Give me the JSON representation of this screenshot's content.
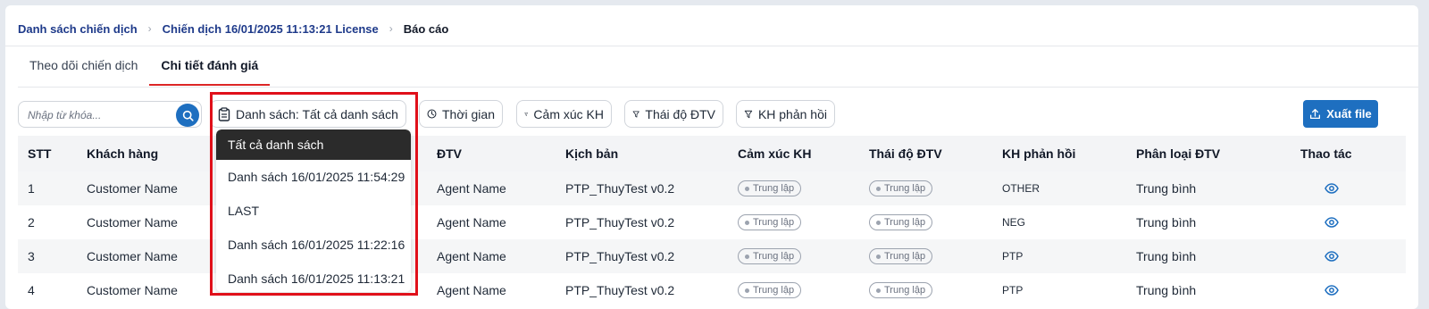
{
  "breadcrumb": {
    "items": [
      "Danh sách chiến dịch",
      "Chiến dịch 16/01/2025 11:13:21 License",
      "Báo cáo"
    ]
  },
  "tabs": [
    {
      "label": "Theo dõi chiến dịch",
      "active": false
    },
    {
      "label": "Chi tiết đánh giá",
      "active": true
    }
  ],
  "toolbar": {
    "search_placeholder": "Nhập từ khóa...",
    "list_filter": "Danh sách: Tất cả danh sách",
    "time_filter": "Thời gian",
    "emotion_filter": "Cảm xúc KH",
    "attitude_filter": "Thái độ ĐTV",
    "feedback_filter": "KH phản hồi",
    "export_label": "Xuất file"
  },
  "dropdown": {
    "options": [
      "Tất cả danh sách",
      "Danh sách 16/01/2025 11:54:29",
      "LAST",
      "Danh sách 16/01/2025 11:22:16",
      "Danh sách 16/01/2025 11:13:21"
    ],
    "selected_index": 0
  },
  "table": {
    "headers": [
      "STT",
      "Khách hàng",
      "ĐTV",
      "Kịch bản",
      "Cảm xúc KH",
      "Thái độ ĐTV",
      "KH phản hồi",
      "Phân loại ĐTV",
      "Thao tác"
    ],
    "rows": [
      {
        "stt": "1",
        "customer": "Customer Name",
        "agent": "Agent Name",
        "script": "PTP_ThuyTest v0.2",
        "emotion": "Trung lập",
        "attitude": "Trung lập",
        "feedback": "OTHER",
        "classification": "Trung bình"
      },
      {
        "stt": "2",
        "customer": "Customer Name",
        "agent": "Agent Name",
        "script": "PTP_ThuyTest v0.2",
        "emotion": "Trung lập",
        "attitude": "Trung lập",
        "feedback": "NEG",
        "classification": "Trung bình"
      },
      {
        "stt": "3",
        "customer": "Customer Name",
        "agent": "Agent Name",
        "script": "PTP_ThuyTest v0.2",
        "emotion": "Trung lập",
        "attitude": "Trung lập",
        "feedback": "PTP",
        "classification": "Trung bình"
      },
      {
        "stt": "4",
        "customer": "Customer Name",
        "agent": "Agent Name",
        "script": "PTP_ThuyTest v0.2",
        "emotion": "Trung lập",
        "attitude": "Trung lập",
        "feedback": "PTP",
        "classification": "Trung bình"
      }
    ]
  },
  "colors": {
    "primary": "#1e6fc0",
    "highlight": "#e0101a",
    "active_tab_underline": "#dc2626",
    "dropdown_selected": "#2b2b2b"
  },
  "icons": {
    "search": "search-icon",
    "list_filter": "clipboard-icon",
    "time_filter": "clock-icon",
    "filter": "filter-funnel-icon",
    "export": "upload-icon",
    "view": "eye-icon",
    "breadcrumb_separator": "chevron-right-icon"
  }
}
